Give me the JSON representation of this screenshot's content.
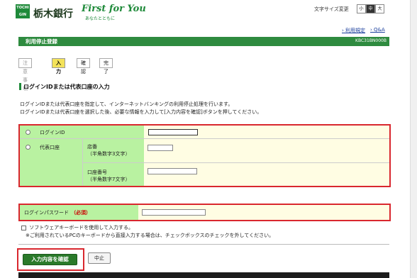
{
  "header": {
    "logo_text": "TOCHI GIN",
    "bank_name": "栃木銀行",
    "slogan_en": "First for You",
    "slogan_jp": "あなたとともに",
    "fontsize_label": "文字サイズ変更",
    "fontsize_buttons": [
      "小",
      "中",
      "大"
    ]
  },
  "toplinks": {
    "terms": "› 利用規定",
    "qa": "› Q&A"
  },
  "titlebar": {
    "title": "利用停止登録",
    "code": "KBC31BN000B"
  },
  "steps": [
    "注意事項",
    "入力",
    "確認",
    "完了"
  ],
  "section": {
    "title": "ログインIDまたは代表口座の入力",
    "desc1": "ログインIDまたは代表口座を指定して、インターネットバンキングの利用停止処理を行います。",
    "desc2": "ログインIDまたは代表口座を選択した後、必要な情報を入力して[入力内容を確認]ボタンを押してください。"
  },
  "form": {
    "login_id_label": "ログインID",
    "rep_account_label": "代表口座",
    "branch_label": "店番",
    "branch_hint": "（半角数字3文字）",
    "account_label": "口座番号",
    "account_hint": "（半角数字7文字）",
    "login_id_value": "",
    "branch_value": "",
    "account_value": ""
  },
  "password": {
    "label": "ログインパスワード",
    "required": "（必須）",
    "value": ""
  },
  "software_keyboard": {
    "label": "ソフトウェアキーボードを使用して入力する。",
    "note": "※ご利用されているPCのキーボードから直接入力する場合は、チェックボックスのチェックを外してください。"
  },
  "buttons": {
    "confirm": "入力内容を確認",
    "cancel": "中止"
  }
}
